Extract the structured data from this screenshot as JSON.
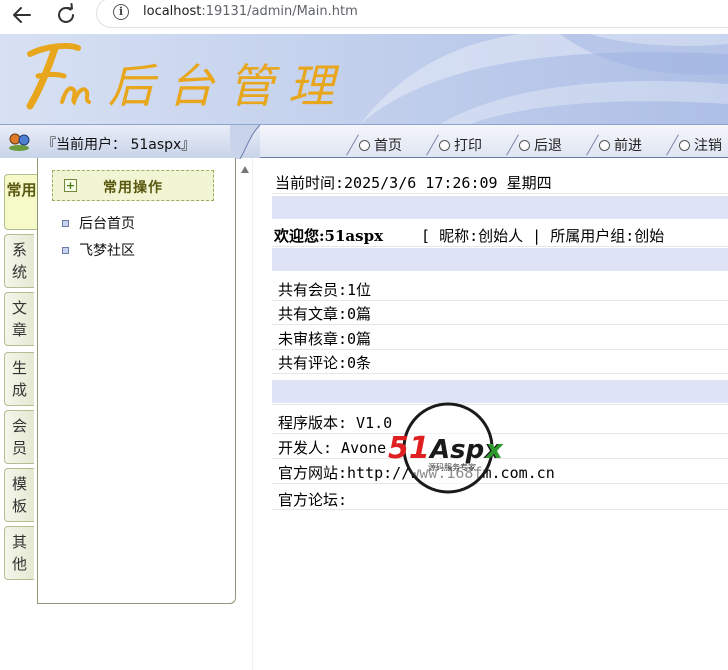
{
  "browser": {
    "url_host": "localhost",
    "url_rest": ":19131/admin/Main.htm"
  },
  "banner": {
    "logo_text": "Fm 后台管理"
  },
  "toolbar": {
    "current_user": "『当前用户： 51aspx』",
    "buttons": [
      {
        "label": "首页"
      },
      {
        "label": "打印"
      },
      {
        "label": "后退"
      },
      {
        "label": "前进"
      },
      {
        "label": "注销"
      }
    ]
  },
  "vtabs": [
    {
      "label": "常用",
      "active": true
    },
    {
      "label": "系统"
    },
    {
      "label": "文章"
    },
    {
      "label": "生成"
    },
    {
      "label": "会员"
    },
    {
      "label": "模板"
    },
    {
      "label": "其他"
    }
  ],
  "sidepanel": {
    "title": "常用操作",
    "items": [
      {
        "label": "后台首页"
      },
      {
        "label": "飞梦社区"
      }
    ]
  },
  "main": {
    "current_time": "当前时间:2025/3/6 17:26:09 星期四",
    "welcome": {
      "greeting": "欢迎您:51aspx",
      "info": "[ 昵称:创始人 | 所属用户组:创始"
    },
    "stats": [
      {
        "text": "共有会员:1位"
      },
      {
        "text": "共有文章:0篇"
      },
      {
        "text": "未审核章:0篇"
      },
      {
        "text": "共有评论:0条"
      }
    ],
    "about": [
      {
        "text": "程序版本: V1.0"
      },
      {
        "text": "开发人:    Avone"
      },
      {
        "text": "官方网站:http://www.168fm.com.cn"
      },
      {
        "text": "官方论坛:"
      }
    ]
  },
  "watermark": {
    "brand": "51Aspx",
    "tagline": "源码服务专家"
  },
  "colors": {
    "band": "#dfe3f6",
    "toolbar_border": "#6b7fae",
    "tab_active": "#f6f9c8",
    "logo": "#e8a61c"
  }
}
